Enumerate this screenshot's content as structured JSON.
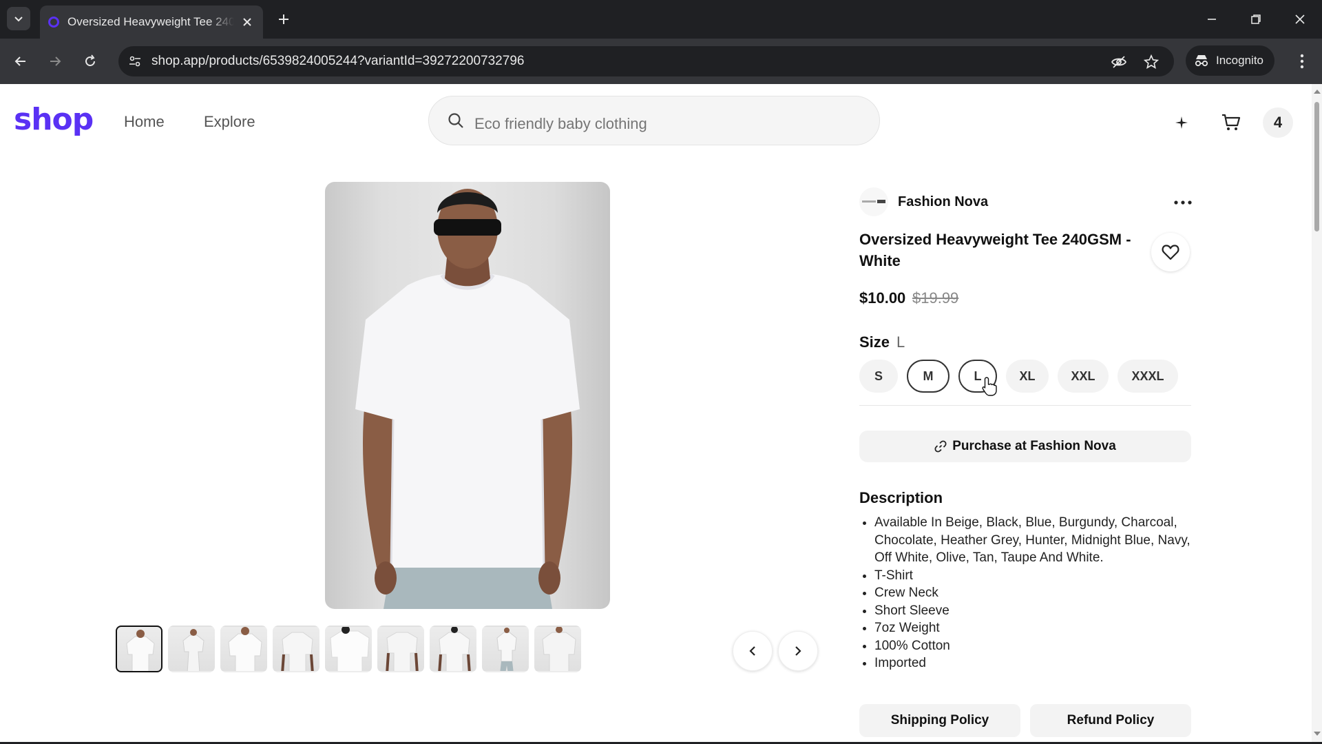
{
  "browser": {
    "tab_title": "Oversized Heavyweight Tee 240GSM - White",
    "url": "shop.app/products/6539824005244?variantId=39272200732796",
    "incognito_label": "Incognito"
  },
  "header": {
    "logo": "shop",
    "nav": [
      "Home",
      "Explore"
    ],
    "search_placeholder": "Eco friendly baby clothing",
    "avatar_initial": "4",
    "icons": [
      "search-icon",
      "sparkle-icon",
      "cart-icon"
    ]
  },
  "product": {
    "merchant": "Fashion Nova",
    "title": "Oversized Heavyweight Tee 240GSM - White",
    "price": "$10.00",
    "compare_price": "$19.99",
    "size_label": "Size",
    "selected_size": "L",
    "sizes": [
      "S",
      "M",
      "L",
      "XL",
      "XXL",
      "XXXL"
    ],
    "purchase_label": "Purchase at Fashion Nova",
    "description_title": "Description",
    "description_items": [
      "Available In Beige, Black, Blue, Burgundy, Charcoal, Chocolate, Heather Grey, Hunter, Midnight Blue, Navy, Off White, Olive, Tan, Taupe And White.",
      "T-Shirt",
      "Crew Neck",
      "Short Sleeve",
      "7oz Weight",
      "100% Cotton",
      "Imported"
    ],
    "shipping_policy_label": "Shipping Policy",
    "refund_policy_label": "Refund Policy",
    "thumbnail_count": 9
  },
  "colors": {
    "brand": "#5a31f4",
    "chrome_dark": "#1f2023",
    "chrome_mid": "#35363a"
  }
}
